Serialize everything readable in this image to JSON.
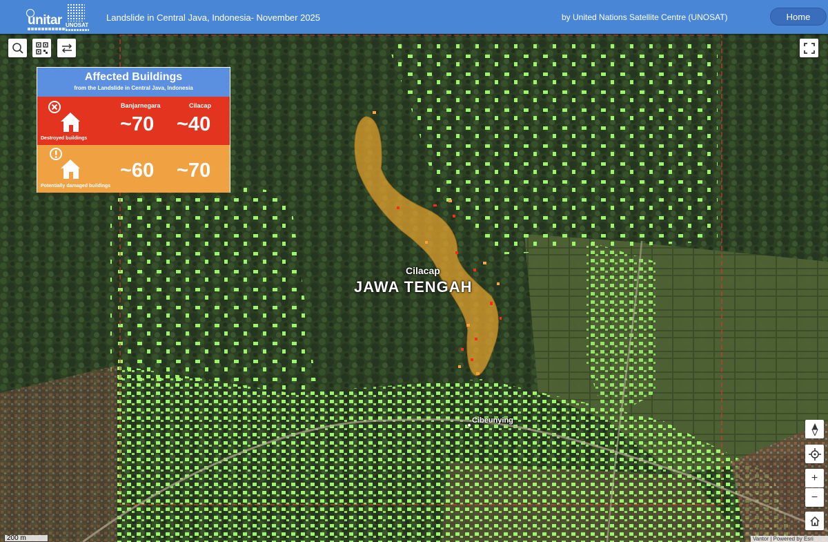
{
  "header": {
    "logo_unitar": "unitar",
    "logo_unosat": "UNOSAT",
    "title": "Landslide in Central Java, Indonesia- November 2025",
    "credit": "by United Nations Satellite Centre (UNOSAT)",
    "home_label": "Home",
    "bg_color": "#4a86d6"
  },
  "toolbar": {
    "search_icon": "search-icon",
    "qr_icon": "qr-code-icon",
    "swipe_icon": "swap-arrows-icon",
    "fullscreen_icon": "fullscreen-icon"
  },
  "legend": {
    "title": "Affected Buildings",
    "subtitle": "from the Landslide in Central Java, Indonesia",
    "columns": [
      "Banjarnegara",
      "Cilacap"
    ],
    "rows": [
      {
        "label": "Destroyed buildings",
        "values": [
          "~70",
          "~40"
        ],
        "color": "#e3341f",
        "icon": "house-destroyed-icon"
      },
      {
        "label": "Potentially damaged buildings",
        "values": [
          "~60",
          "~70"
        ],
        "color": "#f0a243",
        "icon": "house-warning-icon"
      }
    ]
  },
  "map": {
    "labels": {
      "place": "Cilacap",
      "region": "JAWA TENGAH",
      "village": "Cibeunying"
    },
    "scale": "200 m",
    "attribution": "Vantor | Powered by Esri"
  },
  "map_controls": {
    "compass": "compass-icon",
    "locate": "locate-icon",
    "zoom_in": "+",
    "zoom_out": "−",
    "home": "home-icon"
  }
}
